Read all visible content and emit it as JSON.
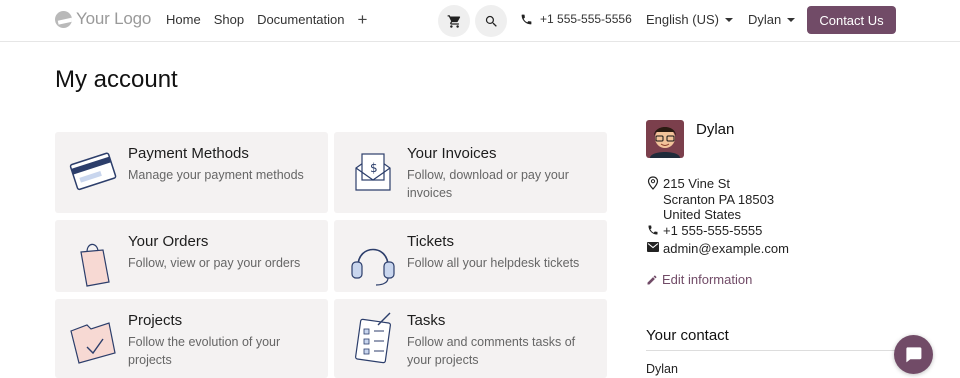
{
  "header": {
    "logo_text": "Your Logo",
    "nav": [
      {
        "label": "Home"
      },
      {
        "label": "Shop"
      },
      {
        "label": "Documentation"
      }
    ],
    "add_label": "+",
    "phone": "+1 555-555-5556",
    "language": "English (US)",
    "user": "Dylan",
    "contact_button": "Contact Us",
    "accent_color": "#714b67"
  },
  "main": {
    "title": "My account",
    "cards": [
      {
        "title": "Payment Methods",
        "desc": "Manage your payment methods",
        "icon": "credit-card-icon"
      },
      {
        "title": "Your Invoices",
        "desc": "Follow, download or pay your invoices",
        "icon": "invoice-envelope-icon"
      },
      {
        "title": "Your Orders",
        "desc": "Follow, view or pay your orders",
        "icon": "shopping-bag-icon"
      },
      {
        "title": "Tickets",
        "desc": "Follow all your helpdesk tickets",
        "icon": "headset-icon"
      },
      {
        "title": "Projects",
        "desc": "Follow the evolution of your projects",
        "icon": "folder-check-icon"
      },
      {
        "title": "Tasks",
        "desc": "Follow and comments tasks of your projects",
        "icon": "clipboard-tasks-icon"
      }
    ]
  },
  "sidebar": {
    "name": "Dylan",
    "address": [
      "215 Vine St",
      "Scranton PA 18503",
      "United States"
    ],
    "phone": "+1 555-555-5555",
    "email": "admin@example.com",
    "edit_label": "Edit information",
    "your_contact_title": "Your contact",
    "contact_name": "Dylan"
  }
}
